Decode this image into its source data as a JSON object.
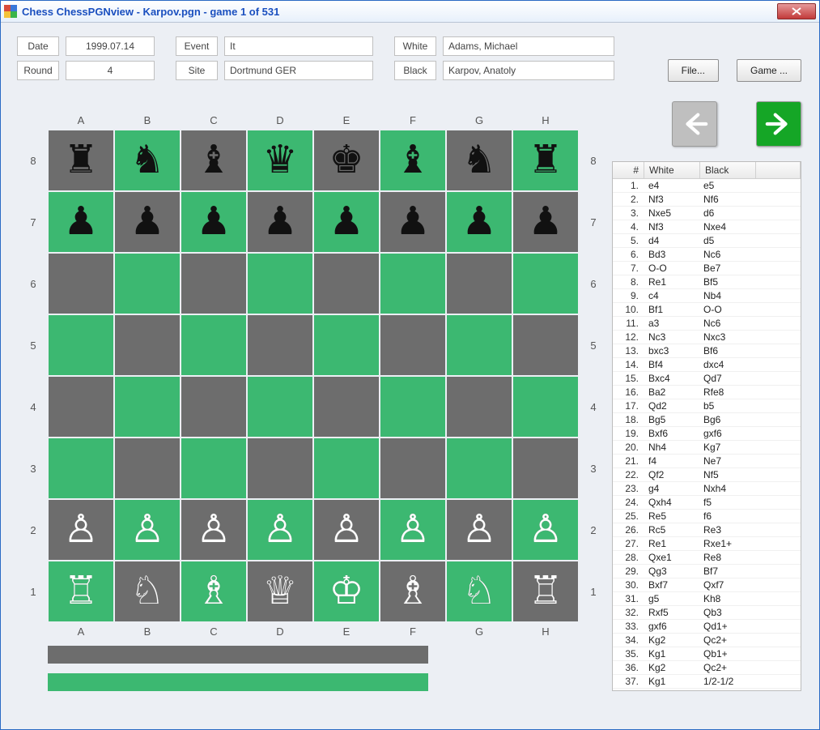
{
  "window": {
    "title": "Chess ChessPGNview - Karpov.pgn - game 1 of 531"
  },
  "meta": {
    "labels": {
      "date": "Date",
      "round": "Round",
      "event": "Event",
      "site": "Site",
      "white": "White",
      "black": "Black"
    },
    "date": "1999.07.14",
    "round": "4",
    "event": "It",
    "site": "Dortmund GER",
    "white": "Adams, Michael",
    "black": "Karpov, Anatoly"
  },
  "buttons": {
    "file": "File...",
    "game": "Game ..."
  },
  "files": [
    "A",
    "B",
    "C",
    "D",
    "E",
    "F",
    "G",
    "H"
  ],
  "ranks": [
    "8",
    "7",
    "6",
    "5",
    "4",
    "3",
    "2",
    "1"
  ],
  "board": [
    [
      "r",
      "n",
      "b",
      "q",
      "k",
      "b",
      "n",
      "r"
    ],
    [
      "p",
      "p",
      "p",
      "p",
      "p",
      "p",
      "p",
      "p"
    ],
    [
      "",
      "",
      "",
      "",
      "",
      "",
      "",
      ""
    ],
    [
      "",
      "",
      "",
      "",
      "",
      "",
      "",
      ""
    ],
    [
      "",
      "",
      "",
      "",
      "",
      "",
      "",
      ""
    ],
    [
      "",
      "",
      "",
      "",
      "",
      "",
      "",
      ""
    ],
    [
      "P",
      "P",
      "P",
      "P",
      "P",
      "P",
      "P",
      "P"
    ],
    [
      "R",
      "N",
      "B",
      "Q",
      "K",
      "B",
      "N",
      "R"
    ]
  ],
  "movelist": {
    "headers": {
      "num": "#",
      "white": "White",
      "black": "Black"
    },
    "moves": [
      {
        "n": "1.",
        "w": "e4",
        "b": "e5"
      },
      {
        "n": "2.",
        "w": "Nf3",
        "b": "Nf6"
      },
      {
        "n": "3.",
        "w": "Nxe5",
        "b": "d6"
      },
      {
        "n": "4.",
        "w": "Nf3",
        "b": "Nxe4"
      },
      {
        "n": "5.",
        "w": "d4",
        "b": "d5"
      },
      {
        "n": "6.",
        "w": "Bd3",
        "b": "Nc6"
      },
      {
        "n": "7.",
        "w": "O-O",
        "b": "Be7"
      },
      {
        "n": "8.",
        "w": "Re1",
        "b": "Bf5"
      },
      {
        "n": "9.",
        "w": "c4",
        "b": "Nb4"
      },
      {
        "n": "10.",
        "w": "Bf1",
        "b": "O-O"
      },
      {
        "n": "11.",
        "w": "a3",
        "b": "Nc6"
      },
      {
        "n": "12.",
        "w": "Nc3",
        "b": "Nxc3"
      },
      {
        "n": "13.",
        "w": "bxc3",
        "b": "Bf6"
      },
      {
        "n": "14.",
        "w": "Bf4",
        "b": "dxc4"
      },
      {
        "n": "15.",
        "w": "Bxc4",
        "b": "Qd7"
      },
      {
        "n": "16.",
        "w": "Ba2",
        "b": "Rfe8"
      },
      {
        "n": "17.",
        "w": "Qd2",
        "b": "b5"
      },
      {
        "n": "18.",
        "w": "Bg5",
        "b": "Bg6"
      },
      {
        "n": "19.",
        "w": "Bxf6",
        "b": "gxf6"
      },
      {
        "n": "20.",
        "w": "Nh4",
        "b": "Kg7"
      },
      {
        "n": "21.",
        "w": "f4",
        "b": "Ne7"
      },
      {
        "n": "22.",
        "w": "Qf2",
        "b": "Nf5"
      },
      {
        "n": "23.",
        "w": "g4",
        "b": "Nxh4"
      },
      {
        "n": "24.",
        "w": "Qxh4",
        "b": "f5"
      },
      {
        "n": "25.",
        "w": "Re5",
        "b": "f6"
      },
      {
        "n": "26.",
        "w": "Rc5",
        "b": "Re3"
      },
      {
        "n": "27.",
        "w": "Re1",
        "b": "Rxe1+"
      },
      {
        "n": "28.",
        "w": "Qxe1",
        "b": "Re8"
      },
      {
        "n": "29.",
        "w": "Qg3",
        "b": "Bf7"
      },
      {
        "n": "30.",
        "w": "Bxf7",
        "b": "Qxf7"
      },
      {
        "n": "31.",
        "w": "g5",
        "b": "Kh8"
      },
      {
        "n": "32.",
        "w": "Rxf5",
        "b": "Qb3"
      },
      {
        "n": "33.",
        "w": "gxf6",
        "b": "Qd1+"
      },
      {
        "n": "34.",
        "w": "Kg2",
        "b": "Qc2+"
      },
      {
        "n": "35.",
        "w": "Kg1",
        "b": "Qb1+"
      },
      {
        "n": "36.",
        "w": "Kg2",
        "b": "Qc2+"
      },
      {
        "n": "37.",
        "w": "Kg1",
        "b": "1/2-1/2"
      }
    ]
  }
}
